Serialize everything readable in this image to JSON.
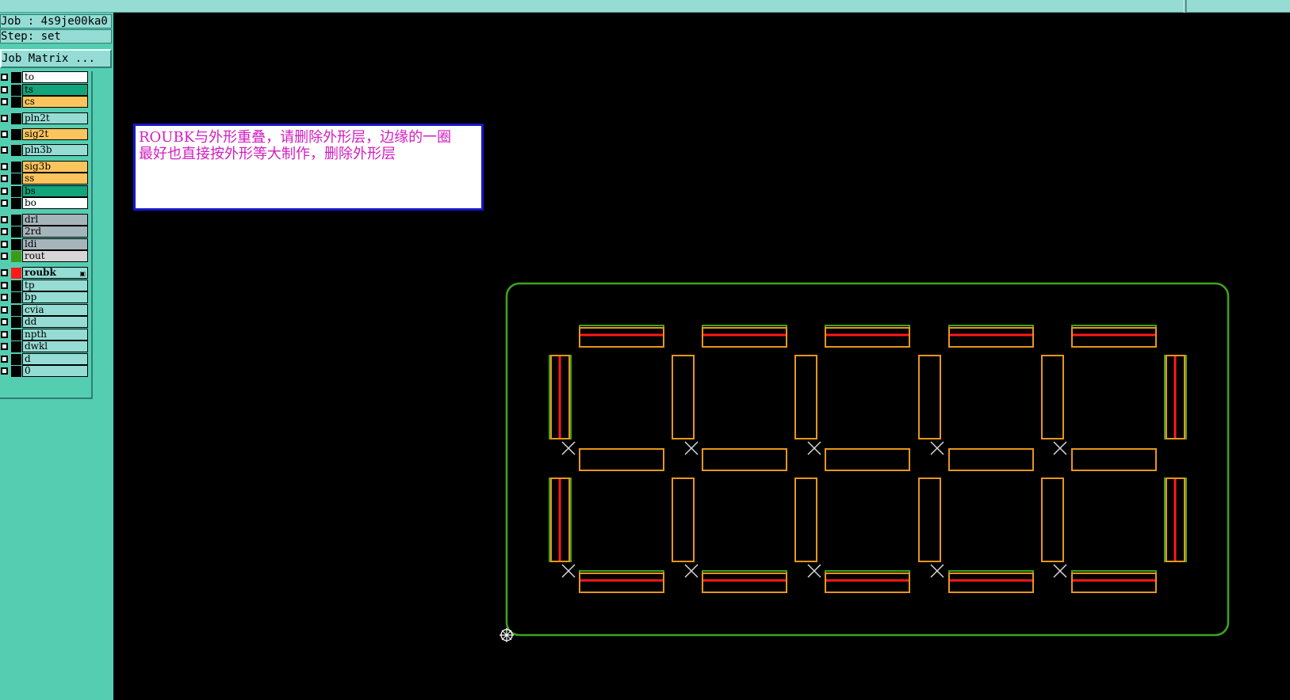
{
  "job": {
    "job_line": "Job : 4s9je00ka0",
    "step_line": "Step: set",
    "matrix_button": "Job Matrix ..."
  },
  "layers": [
    {
      "name": "to",
      "color": "#ffffff",
      "swatch": "#000000"
    },
    {
      "name": "ts",
      "color": "#12a47a",
      "swatch": "#000000"
    },
    {
      "name": "cs",
      "color": "#fcc45c",
      "swatch": "#000000"
    },
    {
      "name": "pln2t",
      "color": "#95dcd4",
      "swatch": "#000000"
    },
    {
      "name": "sig2t",
      "color": "#fcc45c",
      "swatch": "#000000"
    },
    {
      "name": "pln3b",
      "color": "#95dcd4",
      "swatch": "#000000"
    },
    {
      "name": "sig3b",
      "color": "#fcc45c",
      "swatch": "#000000"
    },
    {
      "name": "ss",
      "color": "#fcc45c",
      "swatch": "#000000"
    },
    {
      "name": "bs",
      "color": "#12a47a",
      "swatch": "#000000"
    },
    {
      "name": "bo",
      "color": "#ffffff",
      "swatch": "#000000"
    },
    {
      "name": "drl",
      "color": "#a6b4bb",
      "swatch": "#000000"
    },
    {
      "name": "2rd",
      "color": "#a6b4bb",
      "swatch": "#000000"
    },
    {
      "name": "ldi",
      "color": "#a6b4bb",
      "swatch": "#000000"
    },
    {
      "name": "rout",
      "color": "#d6d6d6",
      "swatch": "#3c9a1a"
    },
    {
      "name": "roubk",
      "color": "#95dcd4",
      "swatch": "#ff1a1a",
      "mark": "▣"
    },
    {
      "name": "tp",
      "color": "#95dcd4",
      "swatch": "#000000"
    },
    {
      "name": "bp",
      "color": "#95dcd4",
      "swatch": "#000000"
    },
    {
      "name": "cvia",
      "color": "#95dcd4",
      "swatch": "#000000"
    },
    {
      "name": "dd",
      "color": "#95dcd4",
      "swatch": "#000000"
    },
    {
      "name": "npth",
      "color": "#95dcd4",
      "swatch": "#000000"
    },
    {
      "name": "dwkl",
      "color": "#95dcd4",
      "swatch": "#000000"
    },
    {
      "name": "d",
      "color": "#95dcd4",
      "swatch": "#000000"
    },
    {
      "name": "0",
      "color": "#95dcd4",
      "swatch": "#000000"
    }
  ],
  "note": {
    "text": "ROUBK与外形重叠，请删除外形层，边缘的一圈\n最好也直接按外形等大制作，删除外形层"
  },
  "colors": {
    "outline": "#3fa31f",
    "rout": "#e7961a",
    "roubk": "#ff1a1a",
    "cross": "#d8d8d8",
    "background": "#000000"
  }
}
